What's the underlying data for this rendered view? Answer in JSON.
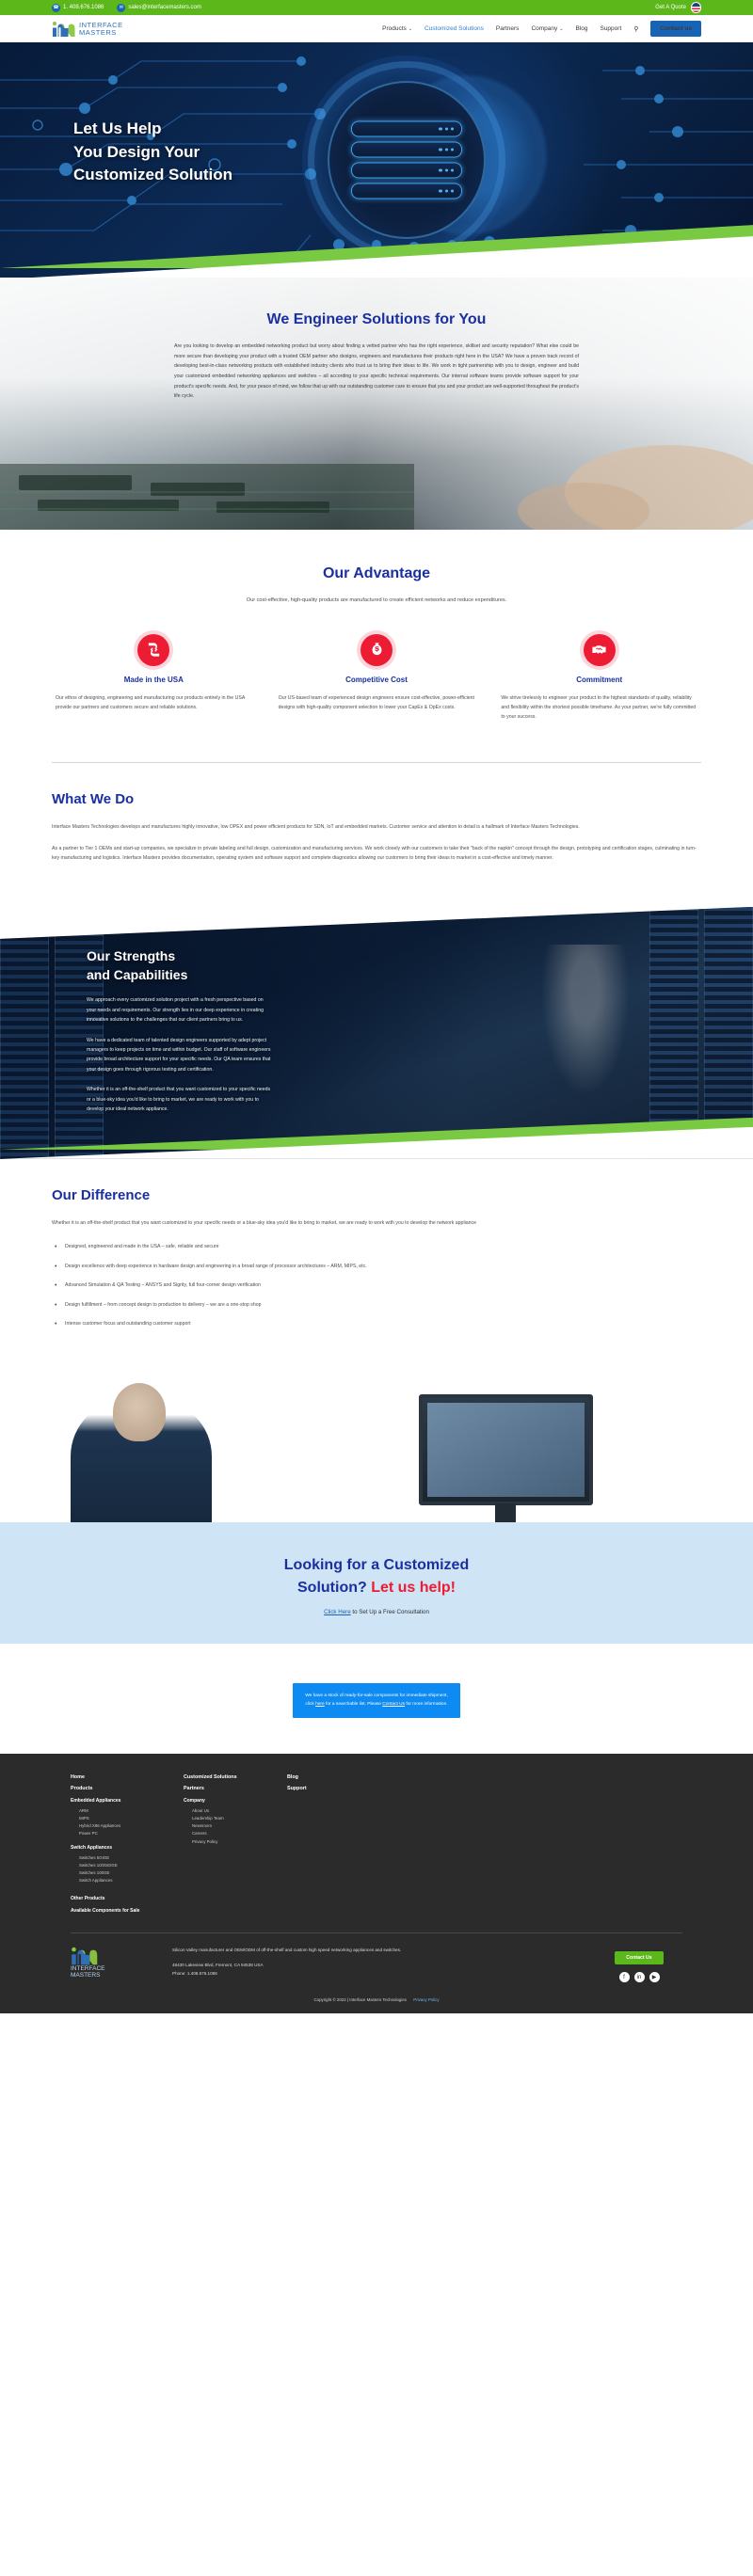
{
  "topbar": {
    "phone": "1. 408.676.1086",
    "email": "sales@interfacemasters.com",
    "quote": "Get A Quote",
    "phone_icon": "phone-icon",
    "mail_icon": "mail-icon",
    "flag_icon": "usa-flag-icon"
  },
  "nav": {
    "logo_line1": "INTERFACE",
    "logo_line2": "MASTERS",
    "items": [
      {
        "label": "Products",
        "caret": "⌄",
        "active": false
      },
      {
        "label": "Customized Solutions",
        "caret": "",
        "active": true
      },
      {
        "label": "Partners",
        "caret": "",
        "active": false
      },
      {
        "label": "Company",
        "caret": "⌄",
        "active": false
      },
      {
        "label": "Blog",
        "caret": "",
        "active": false
      },
      {
        "label": "Support",
        "caret": "",
        "active": false
      }
    ],
    "search_icon": "search-icon",
    "contact_label": "Contact us"
  },
  "hero": {
    "line1": "Let Us Help",
    "line2": "You Design Your",
    "line3": "Customized Solution",
    "scroll_arrow": "↓"
  },
  "engineer": {
    "title": "We Engineer Solutions for You",
    "body": "Are you looking to develop an embedded networking product but worry about finding a vetted partner who has the right experience, skillset and security reputation? What else could be more secure than developing your product with a trusted OEM partner who designs, engineers and manufactures their products right here in the USA? We have a proven track record of developing best-in-class networking products with established industry clients who trust us to bring their ideas to life. We work in tight partnership with you to design, engineer and build your customized embedded networking appliances and switches – all according to your specific technical requirements. Our internal software teams provide software support for your product's specific needs. And, for your peace of mind, we follow that up with our outstanding customer care to ensure that you and your product are well-supported throughout the product's life cycle."
  },
  "advantage": {
    "title": "Our Advantage",
    "subtitle": "Our cost-effective, high-quality products are manufactured to create efficient networks and reduce expenditures.",
    "columns": [
      {
        "icon": "supply-chain-icon",
        "heading": "Made in the USA",
        "body": "Our ethos of designing, engineering and manufacturing our products entirely in the USA provide our partners and customers secure and reliable solutions."
      },
      {
        "icon": "money-bag-icon",
        "heading": "Competitive Cost",
        "body": "Our US-based team of experienced design engineers ensure cost-effective, power-efficient designs with high-quality component selection to lower your CapEx & OpEx costs."
      },
      {
        "icon": "handshake-icon",
        "heading": "Commitment",
        "body": "We strive tirelessly to engineer your product to the highest standards of quality, reliability and flexibility within the shortest possible timeframe. As your partner, we're fully committed to your success."
      }
    ]
  },
  "whatwedo": {
    "title": "What We Do",
    "p1": "Interface Masters Technologies develops and manufactures highly innovative, low OPEX and power efficient products for SDN, IoT and embedded markets. Customer service and attention to detail is a hallmark of Interface Masters Technologies.",
    "p2": "As a partner to Tier 1 OEMs and start-up companies, we specialize in private labeling and full design, customization and manufacturing services. We work closely with our customers to take their \"back of the napkin\" concept through the design, prototyping and certification stages, culminating in turn-key manufacturing and logistics. Interface Masters provides documentation, operating system and software support and complete diagnostics allowing our customers to bring their ideas to market in a cost-effective and timely manner."
  },
  "strengths": {
    "title_line1": "Our Strengths",
    "title_line2": "and Capabilities",
    "p1": "We approach every customized solution project with a fresh perspective based on your needs and requirements. Our strength lies in our deep experience in creating innovative solutions to the challenges that our client partners bring to us.",
    "p2": "We have a dedicated team of talented design engineers supported by adept project managers to keep projects on time and within budget. Our staff of software engineers provide broad architecture support for your specific needs. Our QA team ensures that your design goes through rigorous testing and certification.",
    "p3": "Whether it is an off-the-shelf product that you want customized to your specific needs or a blue-sky idea you'd like to bring to market, we are ready to work with you to develop your ideal network appliance."
  },
  "difference": {
    "title": "Our Difference",
    "intro": "Whether it is an off-the-shelf product that you want customized to your specific needs or a blue-sky idea you'd like to bring to market, we are ready to work with you to develop the network appliance",
    "bullets": [
      "Designed, engineered and made in the USA – safe, reliable and secure",
      "Design excellence with deep experience in hardware design and engineering in a broad range of processor architectures – ARM, MIPS, etc.",
      "Advanced Simulation & QA Testing – ANSYS and Sigrity, full four-corner design verification",
      "Design fulfillment – from concept design to production to delivery – we are a one-stop shop",
      "Intense customer focus and outstanding customer support"
    ]
  },
  "cta": {
    "line1": "Looking for a Customized",
    "line2_a": "Solution? ",
    "line2_b": "Let us help!",
    "link_text": "Click Here",
    "sub_rest": " to Set Up a Free Consultation"
  },
  "notice": {
    "text_a": "We have a stock of ready-for-sale components for immediate shipment, click ",
    "link_here": "here",
    "text_b": " for a searchable list. Please ",
    "link_contact": "Contact Us",
    "text_c": " for more information."
  },
  "footer": {
    "col1": {
      "links": [
        "Home",
        "Products"
      ],
      "group1_title": "Embedded Appliances",
      "group1_items": [
        "ARM",
        "MIPS",
        "Hybrid X86 Appliances",
        "Power PC"
      ],
      "group2_title": "Switch Appliances",
      "group2_items": [
        "Switches 5GIGE",
        "Switches 10/25GIGE",
        "Switches 100GE",
        "Switch Appliances"
      ],
      "tail": [
        "Other Products",
        "Available Components for Sale"
      ]
    },
    "col2": {
      "links": [
        "Customized Solutions",
        "Partners"
      ],
      "group_title": "Company",
      "group_items": [
        "About Us",
        "Leadership Team",
        "Newsroom",
        "Careers",
        "Privacy Policy"
      ]
    },
    "col3": {
      "links": [
        "Blog",
        "Support"
      ]
    },
    "logo_line1": "INTERFACE",
    "logo_line2": "MASTERS",
    "tagline": "Silicon Valley manufacturer and OEM/ODM of off-the-shelf and custom high speed networking appliances and switches.",
    "address": "48430 Lakeview Blvd, Fremont, CA 94538 USA",
    "phone": "Phone: 1.408.676.1086",
    "contact_label": "Contact Us",
    "socials": [
      "f",
      "in",
      "▶"
    ],
    "copyright": "Copyright © 2022 | Interface Masters Technologies",
    "privacy": "Privacy Policy"
  }
}
